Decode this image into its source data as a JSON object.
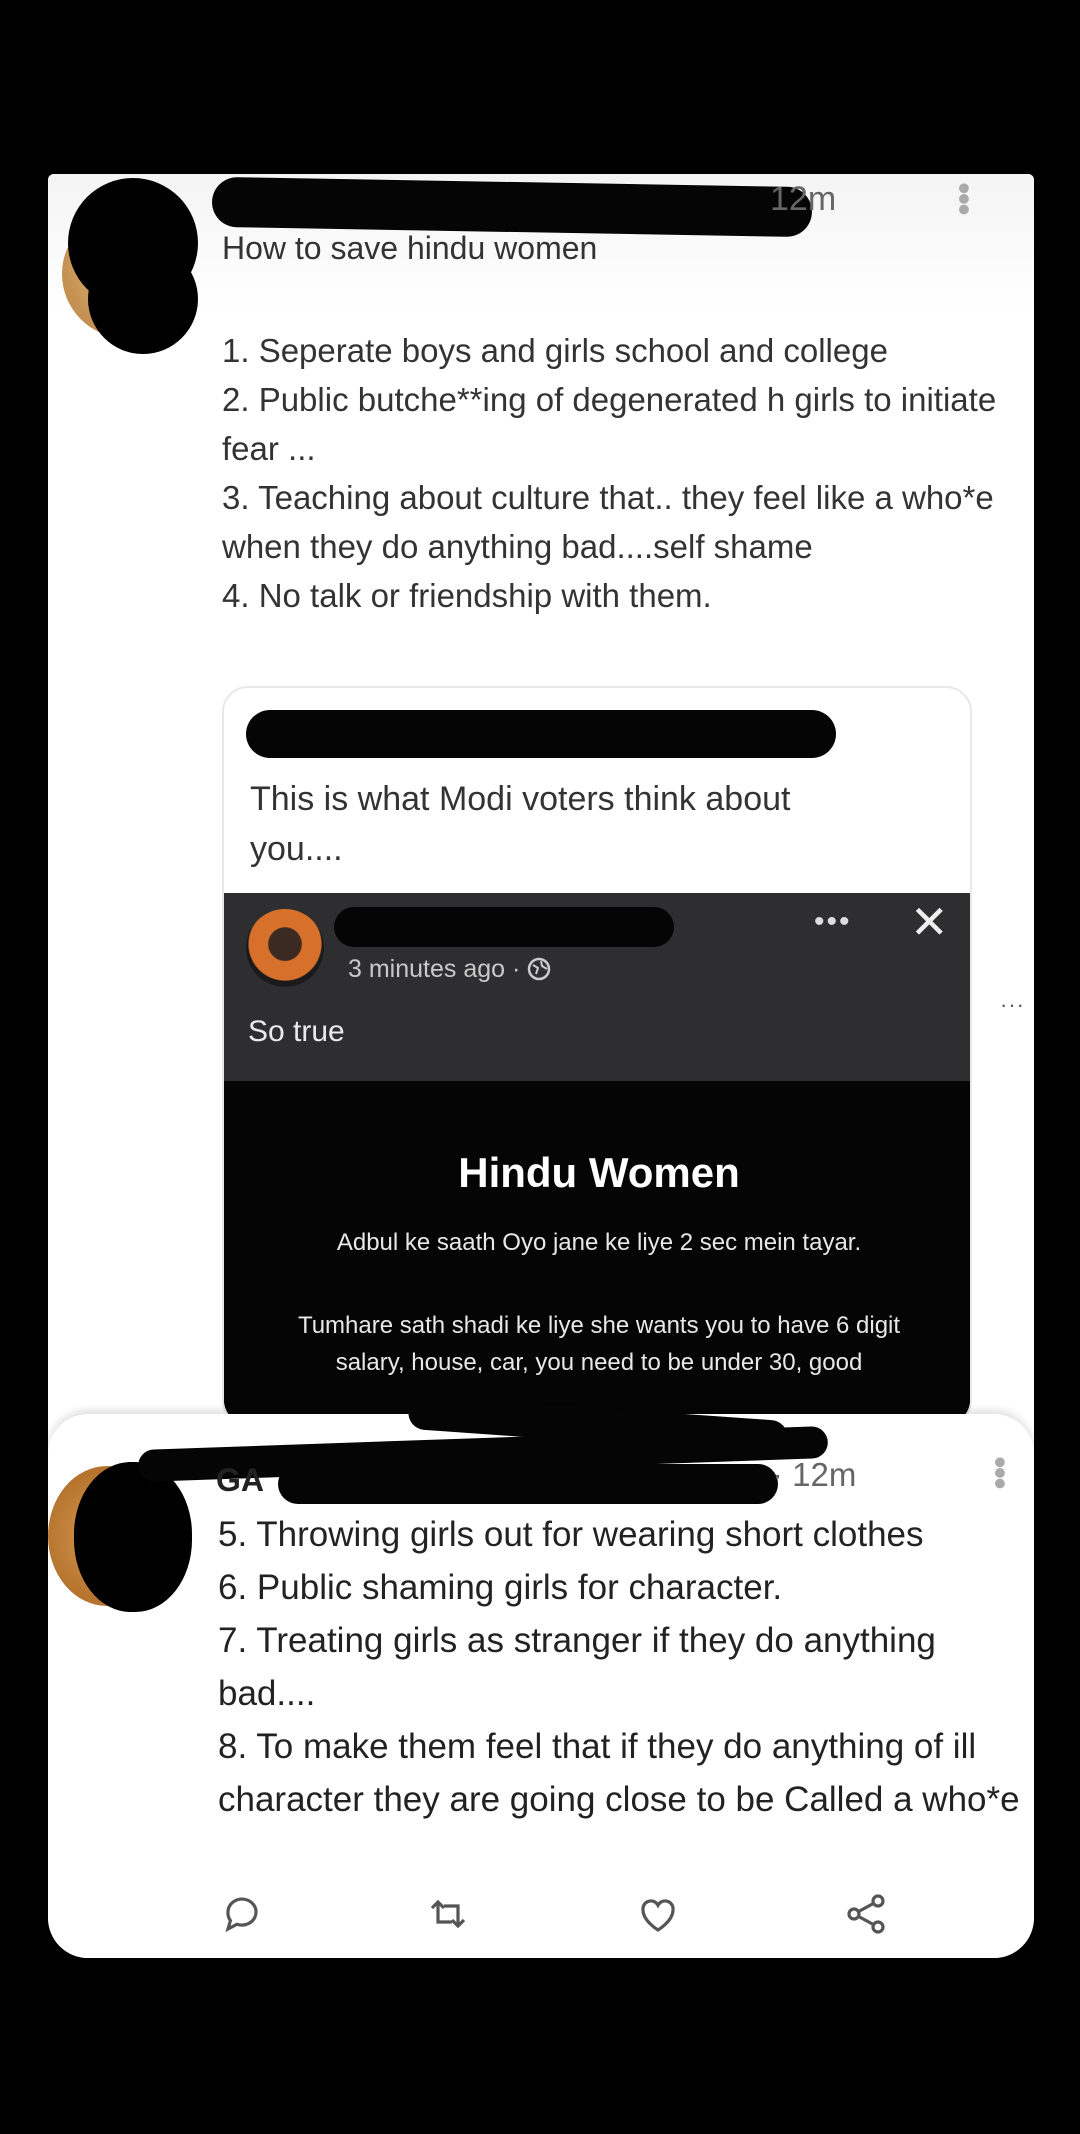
{
  "tweet1": {
    "time": "12m",
    "title": "How to save hindu women",
    "lines": [
      "1. Seperate boys and girls school and college",
      "2. Public butche**ing of degenerated h girls to initiate fear ...",
      "3. Teaching about culture that.. they feel like a who*e when they do anything bad....self shame",
      "4. No talk or friendship with them."
    ]
  },
  "quote": {
    "text": "This is what Modi voters think about you....",
    "post": {
      "meta": "3 minutes ago ·",
      "caption": "So true",
      "card_title": "Hindu Women",
      "card_line1": "Adbul ke saath Oyo jane ke liye 2 sec mein tayar.",
      "card_line2": "Tumhare sath shadi ke liye she wants you to have 6 digit salary, house, car, you need to be under 30, good"
    }
  },
  "tweet2": {
    "name_visible": "GA",
    "time": "· 12m",
    "lines": [
      "5. Throwing girls out for wearing short clothes",
      "6. Public shaming girls for character.",
      "7. Treating girls as stranger if they do anything bad....",
      "8. To make them feel that if they do anything of ill character they are going close to be Called a who*e"
    ]
  },
  "icons": {
    "reply": "reply-icon",
    "retweet": "retweet-icon",
    "like": "heart-icon",
    "share": "share-icon",
    "globe": "globe-icon",
    "more": "more-icon",
    "close": "close-icon"
  }
}
